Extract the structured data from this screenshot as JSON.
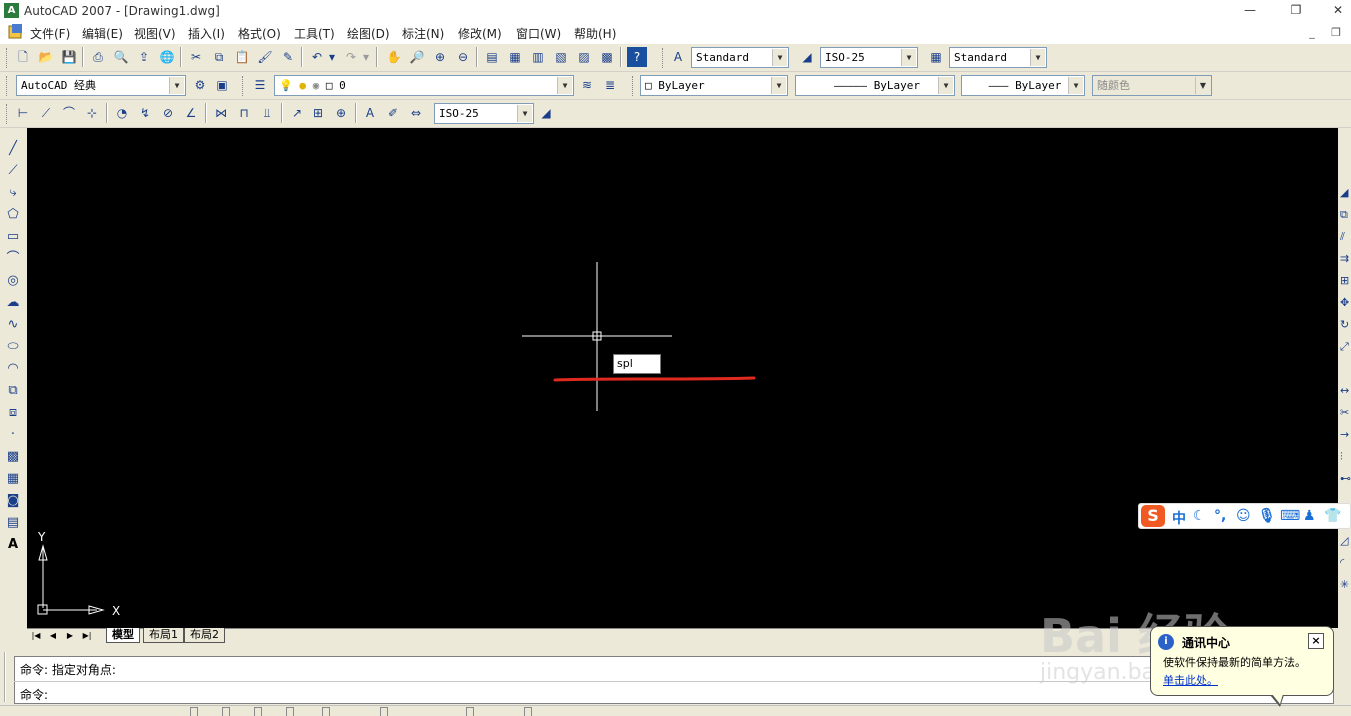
{
  "window": {
    "title": "AutoCAD 2007 - [Drawing1.dwg]",
    "controls": {
      "minimize": "—",
      "restore": "❐",
      "close": "✕"
    },
    "mdi_controls": {
      "minimize": "_",
      "restore": "❐"
    }
  },
  "menu": {
    "items": [
      "文件(F)",
      "编辑(E)",
      "视图(V)",
      "插入(I)",
      "格式(O)",
      "工具(T)",
      "绘图(D)",
      "标注(N)",
      "修改(M)",
      "窗口(W)",
      "帮助(H)"
    ]
  },
  "toolbars": {
    "text_style": "Standard",
    "dim_style": "ISO-25",
    "table_style": "Standard",
    "workspace": "AutoCAD 经典",
    "layer": "0",
    "color": "ByLayer",
    "linetype": "ByLayer",
    "lineweight": "ByLayer",
    "plot_style": "随颜色",
    "dim_style_2": "ISO-25"
  },
  "canvas": {
    "background": "#000000",
    "crosshair_color": "#ffffff",
    "annotation_color": "#e0291f",
    "tooltip_text": "spl",
    "ucs_x": "X",
    "ucs_y": "Y"
  },
  "tabs": {
    "nav": [
      "|◀",
      "◀",
      "▶",
      "▶|"
    ],
    "items": [
      "模型",
      "布局1",
      "布局2"
    ],
    "active": "模型"
  },
  "command": {
    "history": "命令: 指定对角点:",
    "prompt": "命令:"
  },
  "status": {
    "coords": "",
    "buttons": []
  },
  "ime": {
    "logo": "S",
    "mode": "中",
    "icons": [
      "moon-icon",
      "punctuation-icon",
      "emoji-icon",
      "mic-icon",
      "keyboard-icon",
      "user-icon",
      "shirt-icon"
    ]
  },
  "balloon": {
    "title": "通讯中心",
    "message": "使软件保持最新的简单方法。",
    "link": "单击此处。",
    "close": "×"
  },
  "watermark": {
    "main": "Bai 经验",
    "sub": "jingyan.baidu.com"
  }
}
